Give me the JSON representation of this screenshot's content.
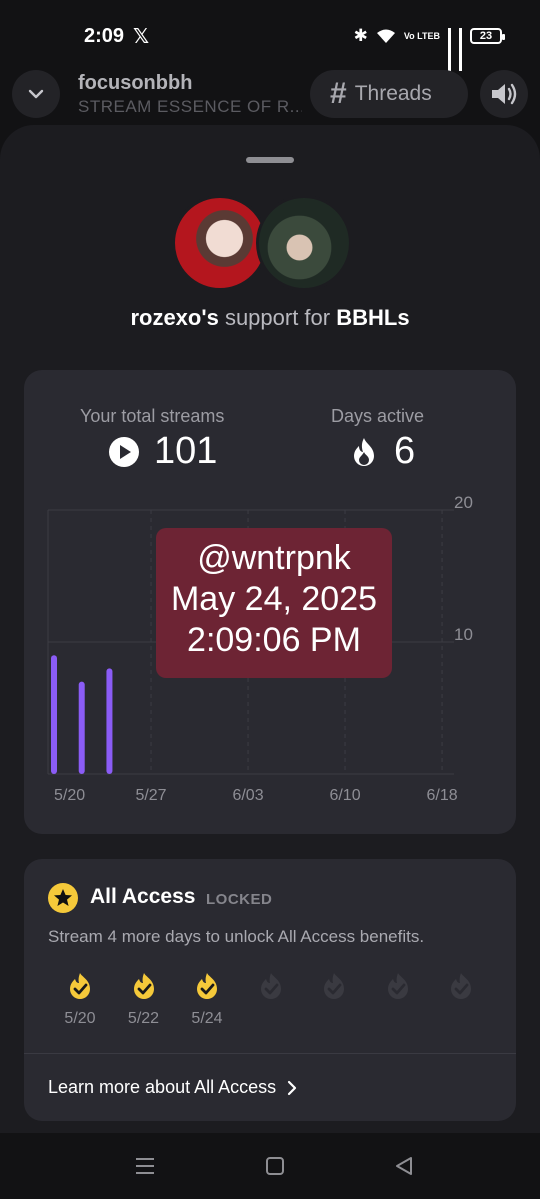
{
  "status": {
    "time": "2:09",
    "battery": "23",
    "volte": "Vo LTEB"
  },
  "player": {
    "title": "focusonbbh",
    "subtitle": "STREAM ESSENCE OF R...",
    "threads_label": "Threads"
  },
  "support": {
    "user": "rozexo's",
    "middle": " support for ",
    "target": "BBHLs"
  },
  "stats": {
    "total_label": "Your total streams",
    "total_value": "101",
    "days_label": "Days active",
    "days_value": "6"
  },
  "chart_data": {
    "type": "bar",
    "x_ticks": [
      "5/20",
      "5/27",
      "6/03",
      "6/10",
      "6/18"
    ],
    "y_ticks": [
      "20",
      "10"
    ],
    "ylim": [
      0,
      20
    ],
    "bars": [
      {
        "date": "5/20",
        "value": 9
      },
      {
        "date": "5/22",
        "value": 7
      },
      {
        "date": "5/24",
        "value": 8
      }
    ],
    "color": "#8b5cf6"
  },
  "tooltip": {
    "line1": "@wntrpnk",
    "line2": "May 24, 2025",
    "line3": "2:09:06 PM"
  },
  "access": {
    "title": "All Access",
    "badge": "LOCKED",
    "description": "Stream 4 more days to unlock All Access benefits.",
    "days": [
      {
        "label": "5/20",
        "done": true
      },
      {
        "label": "5/22",
        "done": true
      },
      {
        "label": "5/24",
        "done": true
      },
      {
        "label": "",
        "done": false
      },
      {
        "label": "",
        "done": false
      },
      {
        "label": "",
        "done": false
      },
      {
        "label": "",
        "done": false
      }
    ],
    "learn_more": "Learn more about All Access"
  },
  "colors": {
    "accent": "#8b5cf6",
    "gold": "#f5c93a",
    "tooltip": "#6d2434"
  }
}
